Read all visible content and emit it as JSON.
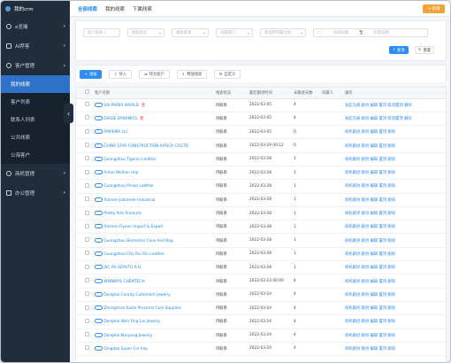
{
  "sidebar": {
    "header": "我的crm",
    "items": [
      {
        "label": "e览撮",
        "chevron": "▾"
      },
      {
        "label": "AI荐客",
        "chevron": "▾"
      },
      {
        "label": "客户管理",
        "chevron": "▴"
      },
      {
        "label": "我的线索",
        "sub": true
      },
      {
        "label": "客户列表",
        "sub": true
      },
      {
        "label": "联系人列表",
        "sub": true
      },
      {
        "label": "公共线索",
        "sub": true
      },
      {
        "label": "公海客户",
        "sub": true
      },
      {
        "label": "商机管理",
        "chevron": "▾"
      },
      {
        "label": "办公管理",
        "chevron": "▾"
      }
    ],
    "collapse_glyph": "‹"
  },
  "topbar": {
    "tabs": [
      "全部线索",
      "我的线索",
      "下属线索"
    ],
    "new_button": "新增"
  },
  "filters": {
    "placeholders": [
      "客户联系人",
      "线索状态",
      "线索来源",
      "归属部门",
      "请选择所属分组",
      "开始日期",
      "结束日期"
    ],
    "date_separator": "至",
    "search_label": "查询",
    "reset_label": "重置"
  },
  "toolbar": [
    "添加",
    "导入",
    "转为客户",
    "释放线索",
    "自定义"
  ],
  "table": {
    "columns": [
      "客户名称",
      "线索状态",
      "最后跟进时间",
      "未跟进天数",
      "归属人",
      "操作"
    ],
    "rows": [
      {
        "name": "SAI PAPER WORLD",
        "flag": "置",
        "status": "待联系",
        "date": "2022-03-05",
        "days": "4",
        "owner": "",
        "ops": "发起沟通 跟进 编辑 置顶 取消置顶 删除"
      },
      {
        "name": "DIODE DYNAMICS",
        "flag": "置",
        "status": "待联系",
        "date": "2022-03-05",
        "days": "4",
        "owner": "",
        "ops": "发起沟通 跟进 编辑 置顶 取消置顶 删除"
      },
      {
        "name": "APIPEMA LLC",
        "flag": "",
        "status": "待联系",
        "date": "2022-03-05",
        "days": "0",
        "owner": "",
        "ops": "商机跟进 跟进 编辑 置顶 删除"
      },
      {
        "name": "CHINA STAR CONSTRUCTION AFRICA CO.LTD",
        "flag": "",
        "status": "待联系",
        "date": "2022-03-29 00:12",
        "days": "0",
        "owner": "",
        "ops": "商机跟进 跟进 编辑 置顶 删除"
      },
      {
        "name": "Guangzhou Tigeniu Leather",
        "flag": "",
        "status": "待联系",
        "date": "2022-03-28",
        "days": "1",
        "owner": "",
        "ops": "商机跟进 跟进 编辑 置顶 删除"
      },
      {
        "name": "Anhui Weihan Imp",
        "flag": "",
        "status": "待联系",
        "date": "2022-03-28",
        "days": "1",
        "owner": "",
        "ops": "商机跟进 跟进 编辑 置顶 删除"
      },
      {
        "name": "Guangzhou Pinlan Leather",
        "flag": "",
        "status": "待联系",
        "date": "2022-03-28",
        "days": "1",
        "owner": "",
        "ops": "商机跟进 跟进 编辑 置顶 删除"
      },
      {
        "name": "Xiamen Jiatiande Industrial",
        "flag": "",
        "status": "待联系",
        "date": "2022-03-28",
        "days": "1",
        "owner": "",
        "ops": "商机跟进 跟进 编辑 置顶 删除"
      },
      {
        "name": "Pretty Arts Products",
        "flag": "",
        "status": "待联系",
        "date": "2022-03-28",
        "days": "1",
        "owner": "",
        "ops": "商机跟进 跟进 编辑 置顶 删除"
      },
      {
        "name": "Xiamen Fiyeon Import & Export",
        "flag": "",
        "status": "待联系",
        "date": "2022-03-28",
        "days": "1",
        "owner": "",
        "ops": "商机跟进 跟进 编辑 置顶 删除"
      },
      {
        "name": "Guangzhou Biometics Case And Bag",
        "flag": "",
        "status": "待联系",
        "date": "2022-03-28",
        "days": "1",
        "owner": "",
        "ops": "商机跟进 跟进 编辑 置顶 删除"
      },
      {
        "name": "Guangzhou City Rui Xin Leather",
        "flag": "",
        "status": "待联系",
        "date": "2022-03-28",
        "days": "1",
        "owner": "",
        "ops": "商机跟进 跟进 编辑 置顶 删除"
      },
      {
        "name": "JSC AV UZAVTO A.G",
        "flag": "",
        "status": "待联系",
        "date": "2022-03-28",
        "days": "1",
        "owner": "",
        "ops": "商机跟进 跟进 编辑 置顶 删除"
      },
      {
        "name": "WINWAYS CHEMTECH",
        "flag": "",
        "status": "待联系",
        "date": "2022-03-23 00:00",
        "days": "4",
        "owner": "",
        "ops": "商机跟进 跟进 编辑 置顶 删除"
      },
      {
        "name": "Donghai County Cutlement Jewelry",
        "flag": "",
        "status": "待联系",
        "date": "2022-03-24",
        "days": "4",
        "owner": "",
        "ops": "商机跟进 跟进 编辑 置顶 删除"
      },
      {
        "name": "Zhongshan Kaike Personal Care Supplies",
        "flag": "",
        "status": "待联系",
        "date": "2022-03-24",
        "days": "4",
        "owner": "",
        "ops": "商机跟进 跟进 编辑 置顶 删除"
      },
      {
        "name": "Donghai Wan Ying Lai Jewelry",
        "flag": "",
        "status": "待联系",
        "date": "2022-03-24",
        "days": "4",
        "owner": "",
        "ops": "商机跟进 跟进 编辑 置顶 删除"
      },
      {
        "name": "Donghai Kunyang Jewelry",
        "flag": "",
        "status": "待联系",
        "date": "2022-03-24",
        "days": "4",
        "owner": "",
        "ops": "商机跟进 跟进 编辑 置顶 删除"
      },
      {
        "name": "Qingdao Super Fur Imp",
        "flag": "",
        "status": "待联系",
        "date": "2022-03-24",
        "days": "4",
        "owner": "",
        "ops": "商机跟进 跟进 编辑 置顶 删除"
      }
    ]
  }
}
